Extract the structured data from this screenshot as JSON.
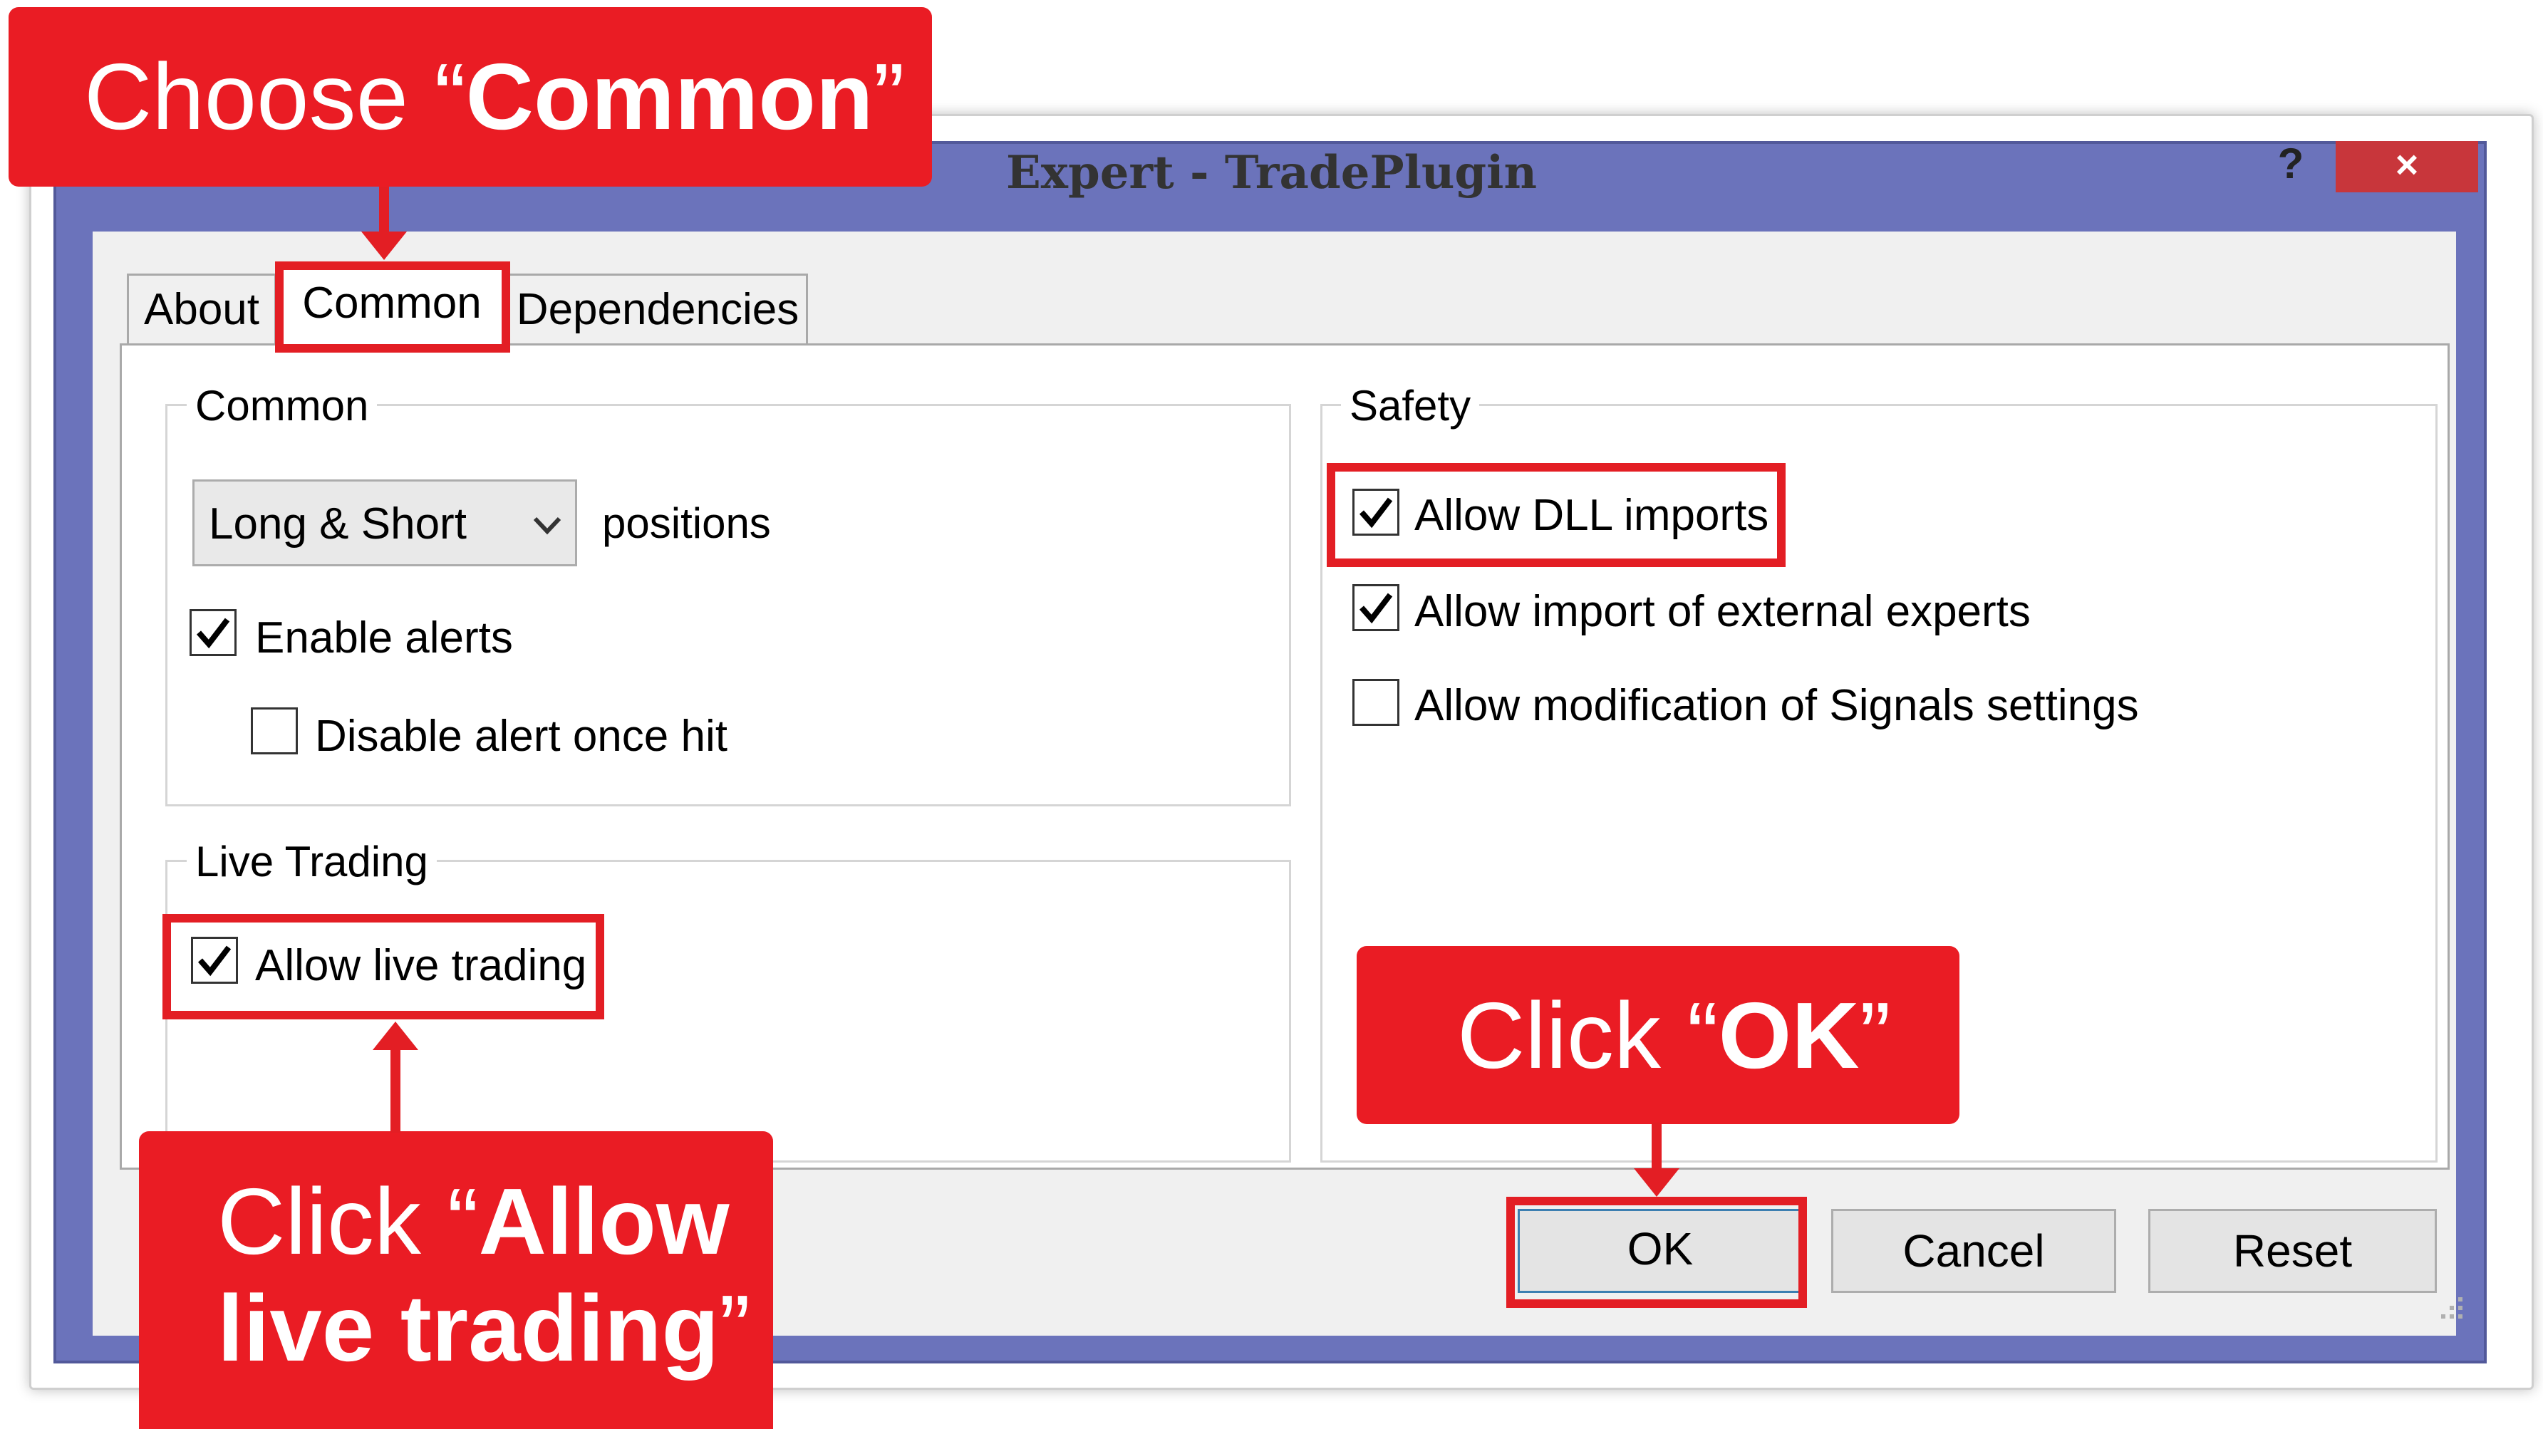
{
  "window": {
    "title": "Expert - TradePlugin",
    "help": "?",
    "close": "×"
  },
  "tabs": [
    {
      "label": "About"
    },
    {
      "label": "Common",
      "selected": true
    },
    {
      "label": "Dependencies"
    }
  ],
  "common_group": {
    "title": "Common",
    "positions_select": {
      "value": "Long & Short"
    },
    "positions_label": "positions",
    "enable_alerts": {
      "label": "Enable alerts",
      "checked": true
    },
    "disable_alert": {
      "label": "Disable alert once hit",
      "checked": false
    }
  },
  "live_group": {
    "title": "Live Trading",
    "allow_live": {
      "label": "Allow live trading",
      "checked": true
    }
  },
  "safety_group": {
    "title": "Safety",
    "allow_dll": {
      "label": "Allow DLL imports",
      "checked": true
    },
    "allow_import": {
      "label": "Allow import of external experts",
      "checked": true
    },
    "allow_signals": {
      "label": "Allow modification of Signals settings",
      "checked": false
    }
  },
  "buttons": {
    "ok": "OK",
    "cancel": "Cancel",
    "reset": "Reset"
  },
  "callouts": {
    "choose_common": {
      "prefix": "Choose “",
      "bold": "Common",
      "suffix": "”"
    },
    "click_ok": {
      "prefix": "Click “",
      "bold": "OK",
      "suffix": "”"
    },
    "allow_live": {
      "prefix": "Click “",
      "bold_line1": "Allow",
      "bold_line2": "live trading",
      "suffix": "”"
    }
  },
  "colors": {
    "callout_red": "#ea1c24",
    "title_bar": "#6b73bb",
    "close_button": "#c8363b"
  }
}
